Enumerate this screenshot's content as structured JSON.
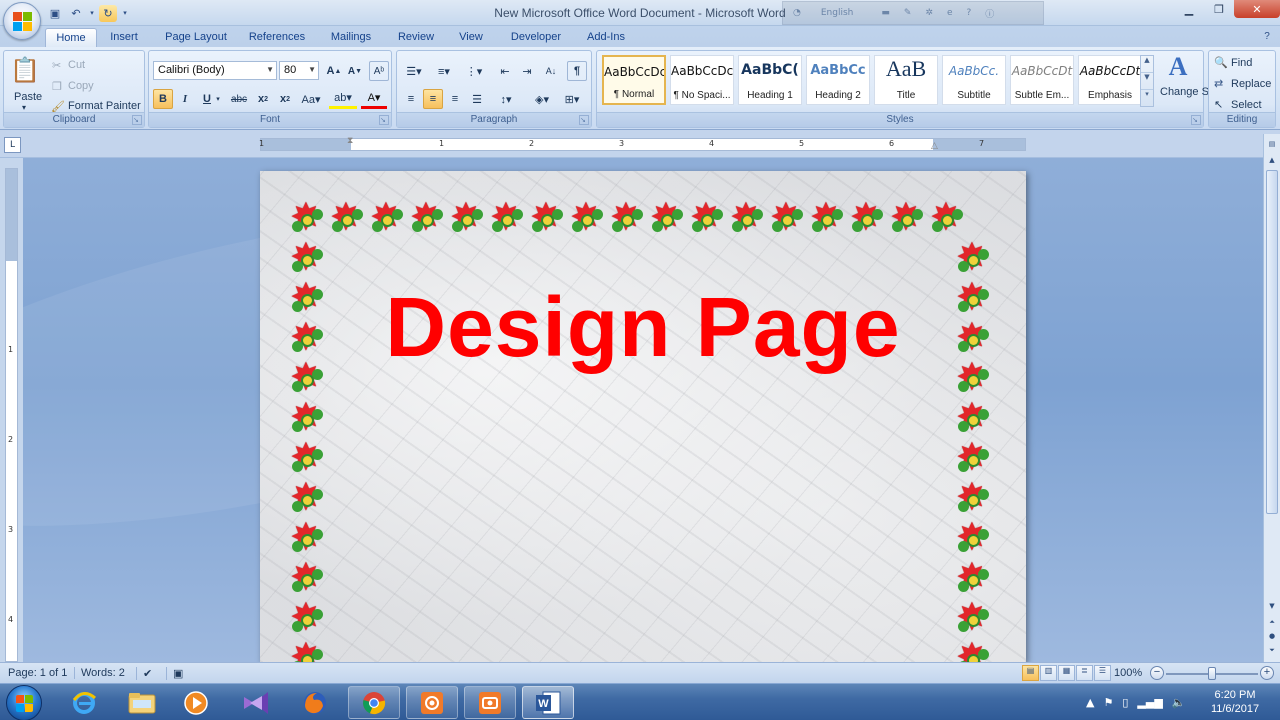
{
  "window": {
    "title": "New Microsoft Office Word Document - Microsoft Word",
    "language": "English"
  },
  "tabs": [
    "Home",
    "Insert",
    "Page Layout",
    "References",
    "Mailings",
    "Review",
    "View",
    "Developer",
    "Add-Ins"
  ],
  "active_tab": "Home",
  "clipboard": {
    "paste": "Paste",
    "cut": "Cut",
    "copy": "Copy",
    "format_painter": "Format Painter",
    "label": "Clipboard"
  },
  "font": {
    "family": "Calibri (Body)",
    "size": "80",
    "label": "Font"
  },
  "paragraph": {
    "label": "Paragraph"
  },
  "styles": {
    "label": "Styles",
    "items": [
      {
        "sample": "AaBbCcDc",
        "name": "¶ Normal"
      },
      {
        "sample": "AaBbCcDc",
        "name": "¶ No Spaci..."
      },
      {
        "sample": "AaBbC(",
        "name": "Heading 1"
      },
      {
        "sample": "AaBbCc",
        "name": "Heading 2"
      },
      {
        "sample": "AaB",
        "name": "Title"
      },
      {
        "sample": "AaBbCc.",
        "name": "Subtitle"
      },
      {
        "sample": "AaBbCcDt",
        "name": "Subtle Em..."
      },
      {
        "sample": "AaBbCcDt",
        "name": "Emphasis"
      }
    ],
    "change_styles": "Change Styles"
  },
  "editing": {
    "find": "Find",
    "replace": "Replace",
    "select": "Select",
    "label": "Editing"
  },
  "ruler": {
    "h_numbers": [
      "1",
      "1",
      "2",
      "3",
      "4",
      "5",
      "6",
      "7"
    ],
    "v_numbers": [
      "1",
      "2",
      "3",
      "4"
    ]
  },
  "document": {
    "heading": "Design Page",
    "heading_color": "#ff0000"
  },
  "status": {
    "page": "Page: 1 of 1",
    "words": "Words: 2",
    "zoom": "100%"
  },
  "taskbar": {
    "time": "6:20 PM",
    "date": "11/6/2017",
    "apps": [
      "internet-explorer",
      "file-explorer",
      "media-player",
      "visual-studio",
      "firefox",
      "chrome",
      "screen-recorder",
      "screenshot-tool",
      "microsoft-word"
    ]
  }
}
